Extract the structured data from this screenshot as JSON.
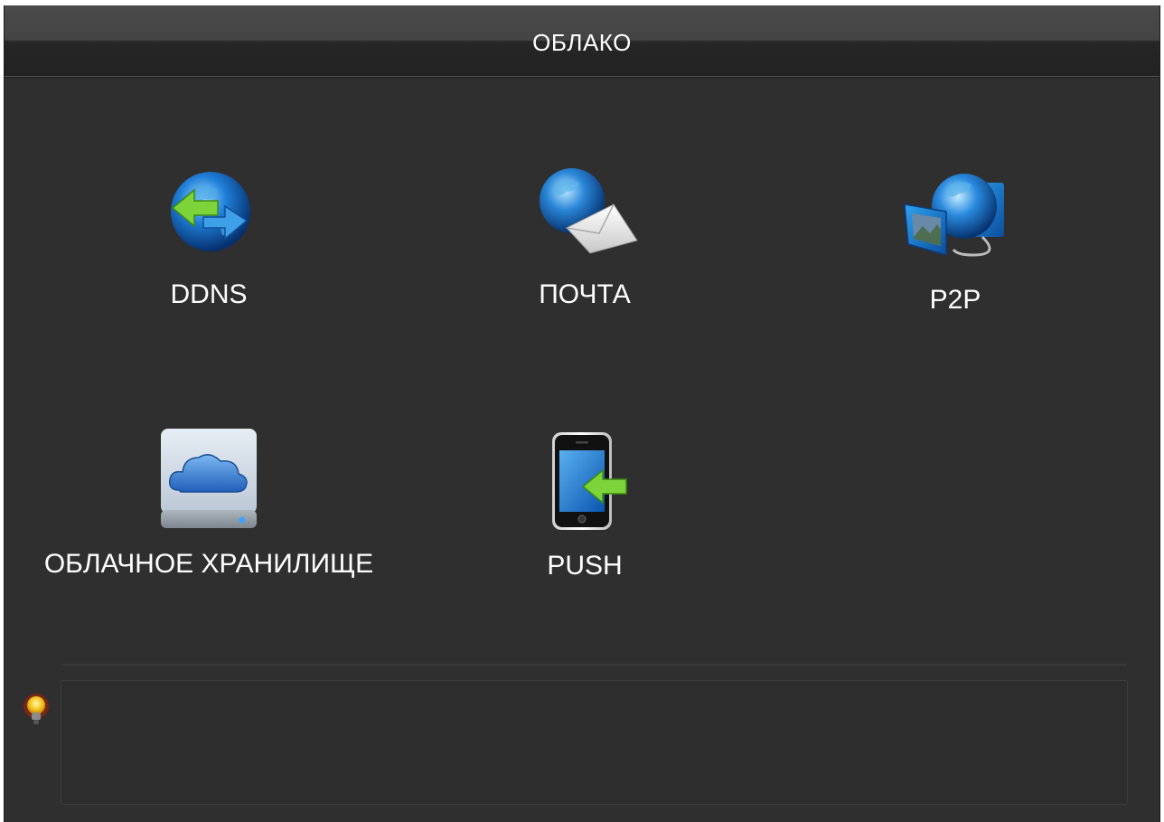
{
  "window": {
    "title": "ОБЛАКО"
  },
  "tiles": [
    {
      "label": "DDNS",
      "icon": "ddns-globe-arrows-icon"
    },
    {
      "label": "ПОЧТА",
      "icon": "email-globe-envelope-icon"
    },
    {
      "label": "P2P",
      "icon": "p2p-globe-monitor-icon"
    },
    {
      "label": "ОБЛАЧНОЕ ХРАНИЛИЩЕ",
      "icon": "cloud-storage-drive-icon"
    },
    {
      "label": "PUSH",
      "icon": "push-phone-arrow-icon"
    }
  ],
  "tip": {
    "icon": "lightbulb-icon",
    "text": ""
  },
  "colors": {
    "background": "#2f2f2f",
    "titlebar_top": "#4a4a4a",
    "titlebar_bottom": "#222222",
    "text": "#ffffff"
  }
}
